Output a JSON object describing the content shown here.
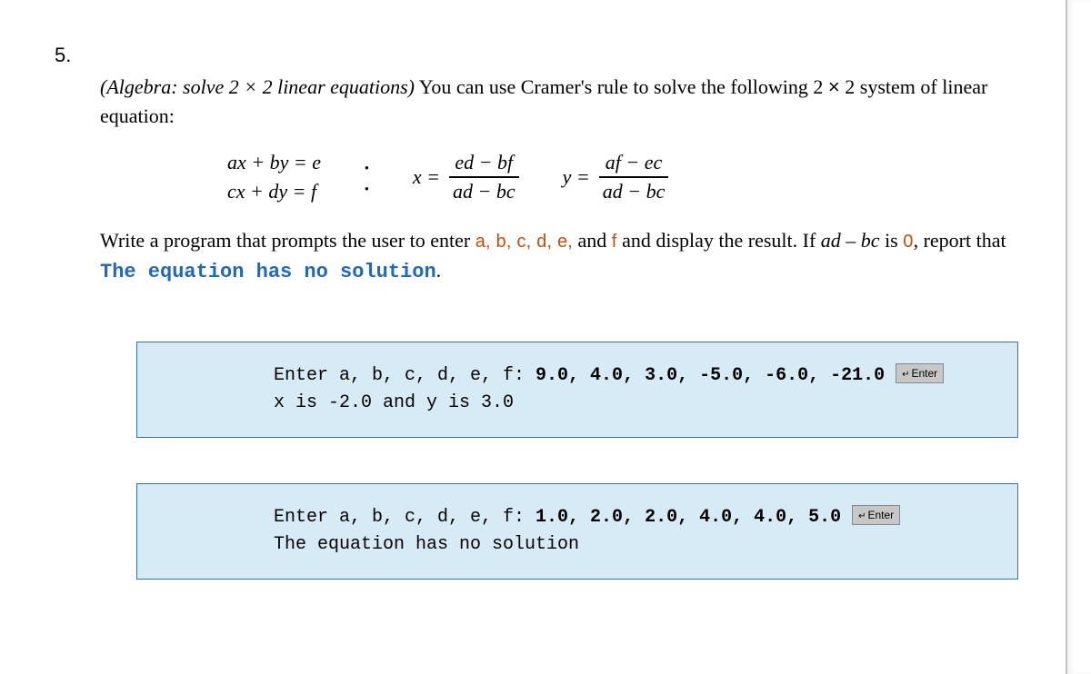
{
  "question_number": "5.",
  "intro": {
    "italic_lead": "(Algebra: solve 2 × 2 linear equations)",
    "rest_1": " You can use Cramer's rule to solve the following 2 ",
    "times": "×",
    "rest_2": " 2 system of linear equation:"
  },
  "system": {
    "line1": "ax + by = e",
    "line2": "cx + dy = f"
  },
  "x_expr": {
    "lhs": "x =",
    "num": "ed − bf",
    "den": "ad − bc"
  },
  "y_expr": {
    "lhs": "y =",
    "num": "af − ec",
    "den": "ad − bc"
  },
  "body": {
    "part1": "Write a program that prompts the user to enter ",
    "vars": "a, b, c, d, e,",
    "and": " and ",
    "f": "f",
    "part2": " and display the result. If ",
    "cond_italic": "ad – bc",
    "is_word": " is ",
    "zero": "0",
    "comma": ", report that ",
    "msg": "The equation has no solution",
    "period": "."
  },
  "examples": [
    {
      "prompt": "Enter a, b, c, d, e, f: ",
      "input": "9.0, 4.0, 3.0, -5.0, -6.0, -21.0",
      "enter_label": "Enter",
      "output": "x is -2.0 and y is 3.0"
    },
    {
      "prompt": "Enter a, b, c, d, e, f: ",
      "input": "1.0, 2.0, 2.0, 4.0, 4.0, 5.0",
      "enter_label": "Enter",
      "output": "The equation has no solution"
    }
  ]
}
